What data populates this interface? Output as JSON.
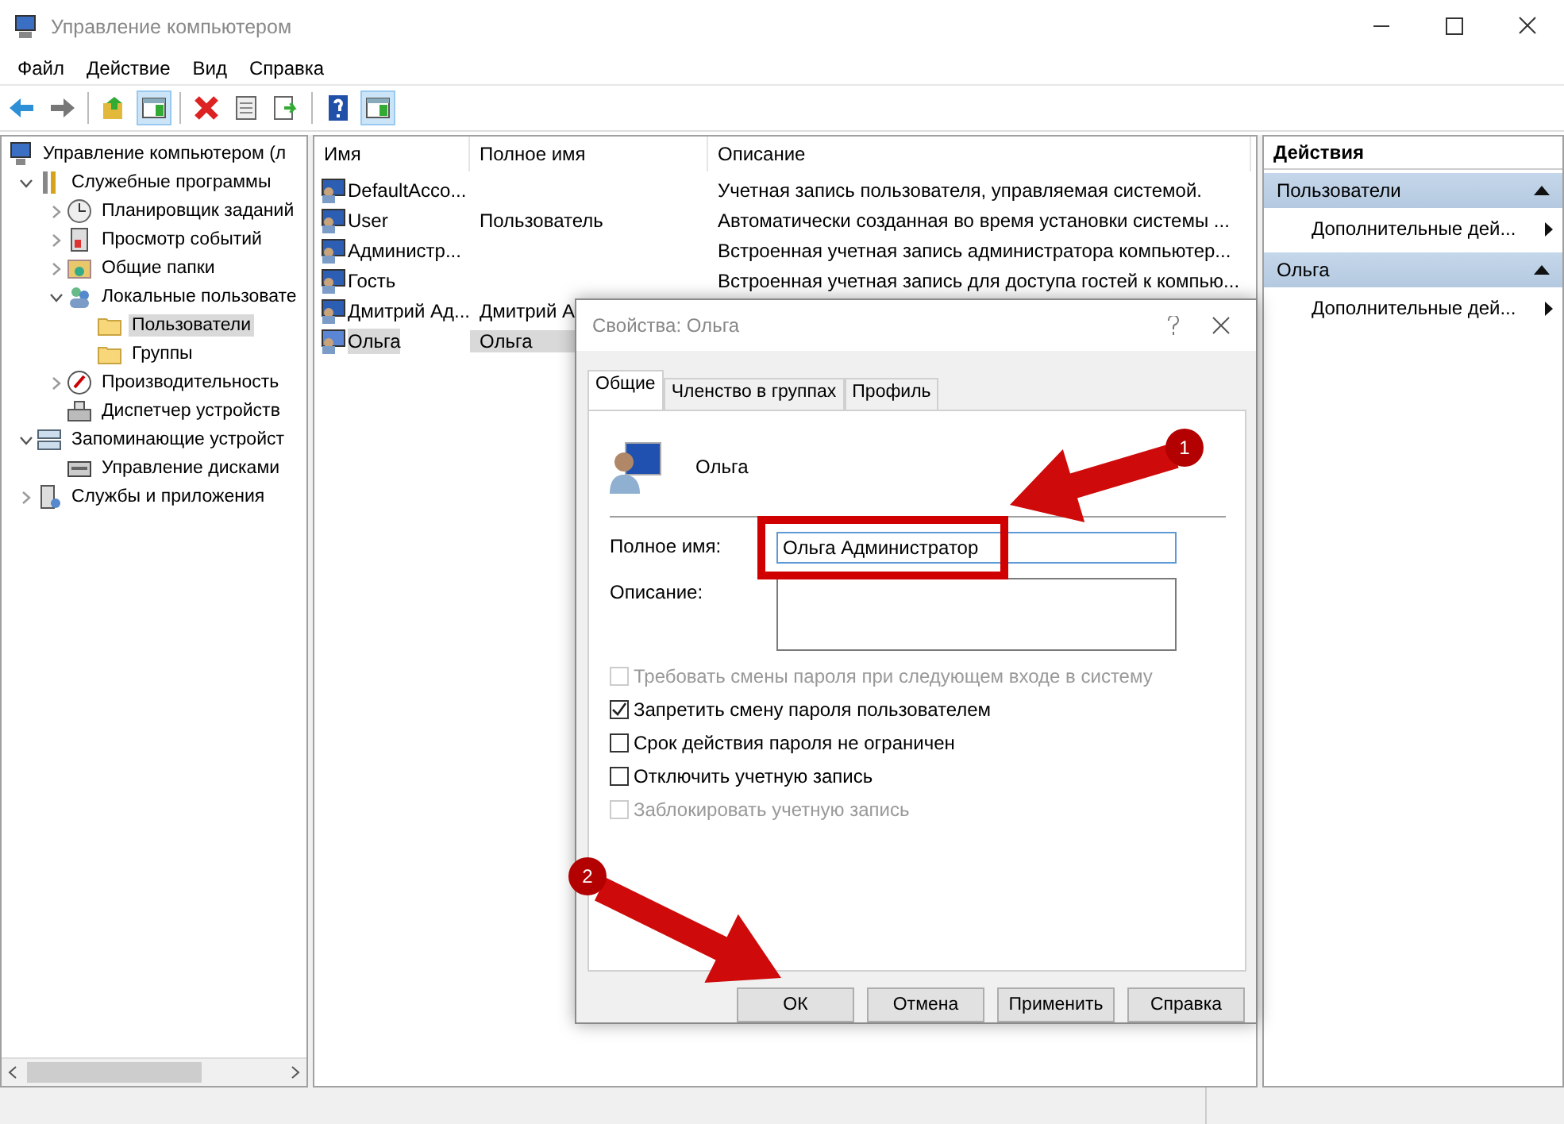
{
  "window": {
    "title": "Управление компьютером"
  },
  "menu": [
    "Файл",
    "Действие",
    "Вид",
    "Справка"
  ],
  "toolbar": [
    {
      "kind": "back",
      "pressed": false
    },
    {
      "kind": "forward",
      "pressed": false
    },
    {
      "kind": "sep"
    },
    {
      "kind": "up",
      "pressed": false
    },
    {
      "kind": "pane",
      "pressed": true
    },
    {
      "kind": "sep"
    },
    {
      "kind": "delete",
      "pressed": false
    },
    {
      "kind": "properties",
      "pressed": false
    },
    {
      "kind": "export",
      "pressed": false
    },
    {
      "kind": "sep"
    },
    {
      "kind": "help",
      "pressed": false
    },
    {
      "kind": "pane",
      "pressed": true
    }
  ],
  "tree": [
    {
      "label": "Управление компьютером (л",
      "kind": "computer",
      "selected": false,
      "children": [
        {
          "label": "Служебные программы",
          "kind": "tools",
          "expanded": true,
          "selected": false,
          "children": [
            {
              "label": "Планировщик заданий",
              "kind": "clock",
              "expanded": false,
              "selected": false
            },
            {
              "label": "Просмотр событий",
              "kind": "log",
              "expanded": false,
              "selected": false
            },
            {
              "label": "Общие папки",
              "kind": "share",
              "expanded": false,
              "selected": false
            },
            {
              "label": "Локальные пользовате",
              "kind": "users",
              "expanded": true,
              "selected": false,
              "children": [
                {
                  "label": "Пользователи",
                  "kind": "folder",
                  "selected": true
                },
                {
                  "label": "Группы",
                  "kind": "folder",
                  "selected": false
                }
              ]
            },
            {
              "label": "Производительность",
              "kind": "gauge",
              "expanded": false,
              "selected": false
            },
            {
              "label": "Диспетчер устройств",
              "kind": "devices",
              "selected": false
            }
          ]
        },
        {
          "label": "Запоминающие устройст",
          "kind": "storage",
          "expanded": true,
          "selected": false,
          "children": [
            {
              "label": "Управление дисками",
              "kind": "disk",
              "selected": false
            }
          ]
        },
        {
          "label": "Службы и приложения",
          "kind": "services",
          "expanded": false,
          "selected": false
        }
      ]
    }
  ],
  "list": {
    "columns": [
      "Имя",
      "Полное имя",
      "Описание"
    ],
    "rows": [
      {
        "name": "DefaultAcco...",
        "full_name": "",
        "description": "Учетная запись пользователя, управляемая системой.",
        "selected": false
      },
      {
        "name": "User",
        "full_name": "Пользователь",
        "description": "Автоматически созданная во время установки системы ...",
        "selected": false
      },
      {
        "name": "Администр...",
        "full_name": "",
        "description": "Встроенная учетная запись администратора компьютер...",
        "selected": false
      },
      {
        "name": "Гость",
        "full_name": "",
        "description": "Встроенная учетная запись для доступа гостей к компью...",
        "selected": false
      },
      {
        "name": "Дмитрий Ад...",
        "full_name": "Дмитрий А",
        "description": "",
        "selected": false
      },
      {
        "name": "Ольга",
        "full_name": "Ольга",
        "description": "",
        "selected": true
      }
    ]
  },
  "actions": {
    "title": "Действия",
    "sections": [
      {
        "title": "Пользователи",
        "items": [
          "Дополнительные дей..."
        ]
      },
      {
        "title": "Ольга",
        "items": [
          "Дополнительные дей..."
        ]
      }
    ]
  },
  "dialog": {
    "title": "Свойства: Ольга",
    "tabs": [
      {
        "label": "Общие",
        "selected": true
      },
      {
        "label": "Членство в группах",
        "selected": false
      },
      {
        "label": "Профиль",
        "selected": false
      }
    ],
    "user_name": "Ольга",
    "full_name": {
      "label": "Полное имя:",
      "value": "Ольга Администратор"
    },
    "description": {
      "label": "Описание:"
    },
    "checkboxes": [
      {
        "label": "Требовать смены пароля при следующем входе в систему",
        "checked": false,
        "disabled": true
      },
      {
        "label": "Запретить смену пароля пользователем",
        "checked": true,
        "disabled": false
      },
      {
        "label": "Срок действия пароля не ограничен",
        "checked": false,
        "disabled": false
      },
      {
        "label": "Отключить учетную запись",
        "checked": false,
        "disabled": false
      },
      {
        "label": "Заблокировать учетную запись",
        "checked": false,
        "disabled": true
      }
    ],
    "buttons": [
      "ОК",
      "Отмена",
      "Применить",
      "Справка"
    ]
  },
  "annotations": [
    {
      "label": "1"
    },
    {
      "label": "2"
    }
  ]
}
